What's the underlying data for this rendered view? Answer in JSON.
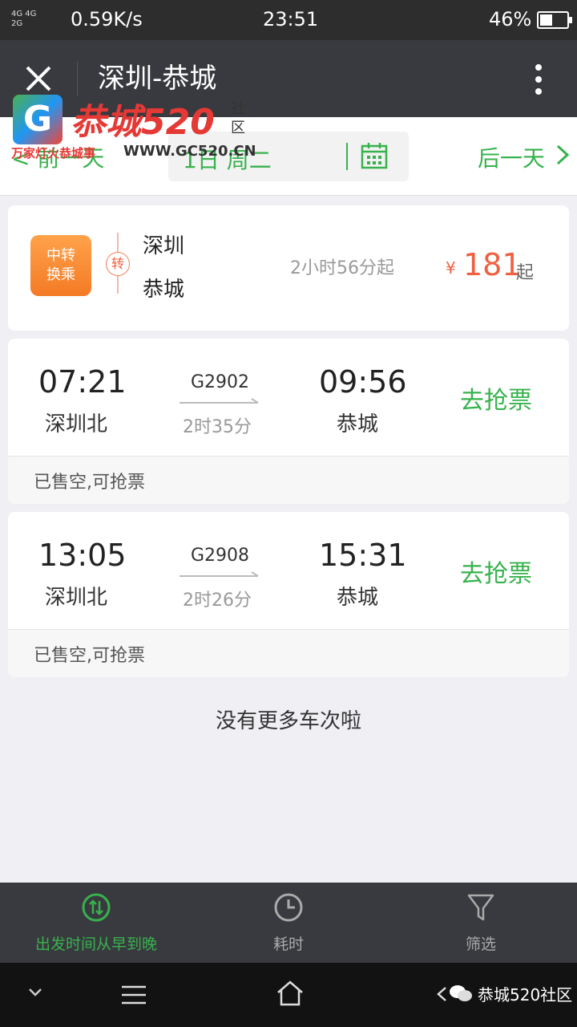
{
  "status_bar": {
    "network": [
      "4G 4G",
      "2G"
    ],
    "speed": "0.59K/s",
    "time": "23:51",
    "battery": "46%",
    "battery_level": 0.46
  },
  "title_bar": {
    "title": "深圳-恭城"
  },
  "date_bar": {
    "prev_label": "< 前一天",
    "date_label": "1日 周二",
    "next_label": "后一天"
  },
  "watermark": {
    "logo_letter": "G",
    "name": "恭城520",
    "side": "社区",
    "slogan": "万家灯火恭城事",
    "url": "WWW.GC520.CN"
  },
  "transfer": {
    "badge_line1": "中转",
    "badge_line2": "换乘",
    "mark": "转",
    "from": "深圳",
    "to": "恭城",
    "duration": "2小时56分起",
    "currency": "¥",
    "price": "181",
    "price_suffix": "起"
  },
  "trains": [
    {
      "depart_time": "07:21",
      "depart_station": "深圳北",
      "train_no": "G2902",
      "duration": "2时35分",
      "arrive_time": "09:56",
      "arrive_station": "恭城",
      "action": "去抢票",
      "status": "已售空,可抢票"
    },
    {
      "depart_time": "13:05",
      "depart_station": "深圳北",
      "train_no": "G2908",
      "duration": "2时26分",
      "arrive_time": "15:31",
      "arrive_station": "恭城",
      "action": "去抢票",
      "status": "已售空,可抢票"
    }
  ],
  "no_more": "没有更多车次啦",
  "tabs": [
    {
      "label": "出发时间从早到晚",
      "icon": "sort-time-icon",
      "active": true
    },
    {
      "label": "耗时",
      "icon": "clock-icon",
      "active": false
    },
    {
      "label": "筛选",
      "icon": "filter-icon",
      "active": false
    }
  ],
  "nav": {
    "brand": "恭城520社区"
  },
  "colors": {
    "accent": "#37b24d",
    "price": "#f06040",
    "titlebar": "#393a3f"
  }
}
